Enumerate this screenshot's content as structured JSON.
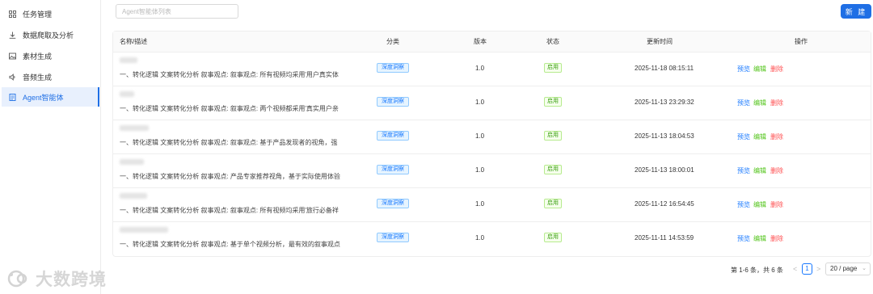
{
  "sidebar": {
    "items": [
      {
        "label": "任务管理",
        "icon": "grid-icon"
      },
      {
        "label": "数据爬取及分析",
        "icon": "download-icon"
      },
      {
        "label": "素材生成",
        "icon": "image-icon"
      },
      {
        "label": "音频生成",
        "icon": "audio-icon"
      },
      {
        "label": "Agent智能体",
        "icon": "document-icon",
        "active": true
      }
    ]
  },
  "toolbar": {
    "search_placeholder": "Agent智能体列表",
    "new_label": "新 建"
  },
  "table": {
    "headers": [
      "名称/描述",
      "分类",
      "版本",
      "状态",
      "更新时间",
      "操作"
    ],
    "rows": [
      {
        "desc": "一、转化逻辑 文案转化分析 叙事观点: 叙事观点: 所有视频均采用'用户真实体",
        "category": "深度洞察",
        "version": "1.0",
        "status": "启用",
        "time": "2025-11-18 08:15:11"
      },
      {
        "desc": "一、转化逻辑 文案转化分析 叙事观点: 叙事观点: 两个视频都采用'真实用户亲",
        "category": "深度洞察",
        "version": "1.0",
        "status": "启用",
        "time": "2025-11-13 23:29:32"
      },
      {
        "desc": "一、转化逻辑 文案转化分析 叙事观点: 叙事观点: 基于产品发现者的视角，强",
        "category": "深度洞察",
        "version": "1.0",
        "status": "启用",
        "time": "2025-11-13 18:04:53"
      },
      {
        "desc": "一、转化逻辑 文案转化分析 叙事观点: 产品专家推荐视角，基于实际使用体验",
        "category": "深度洞察",
        "version": "1.0",
        "status": "启用",
        "time": "2025-11-13 18:00:01"
      },
      {
        "desc": "一、转化逻辑 文案转化分析 叙事观点: 叙事观点: 所有视频均采用'旅行必备祥",
        "category": "深度洞察",
        "version": "1.0",
        "status": "启用",
        "time": "2025-11-12 16:54:45"
      },
      {
        "desc": "一、转化逻辑 文案转化分析 叙事观点: 基于单个视频分析，最有效的叙事观点",
        "category": "深度洞察",
        "version": "1.0",
        "status": "启用",
        "time": "2025-11-11 14:53:59"
      }
    ],
    "actions": {
      "preview": "预览",
      "edit": "编辑",
      "delete": "删除"
    }
  },
  "pagination": {
    "total_text": "第 1-6 条，共 6 条",
    "current_page": "1",
    "page_size": "20 / page",
    "prev": "<",
    "next": ">"
  },
  "watermark": {
    "text": "大数跨境"
  }
}
